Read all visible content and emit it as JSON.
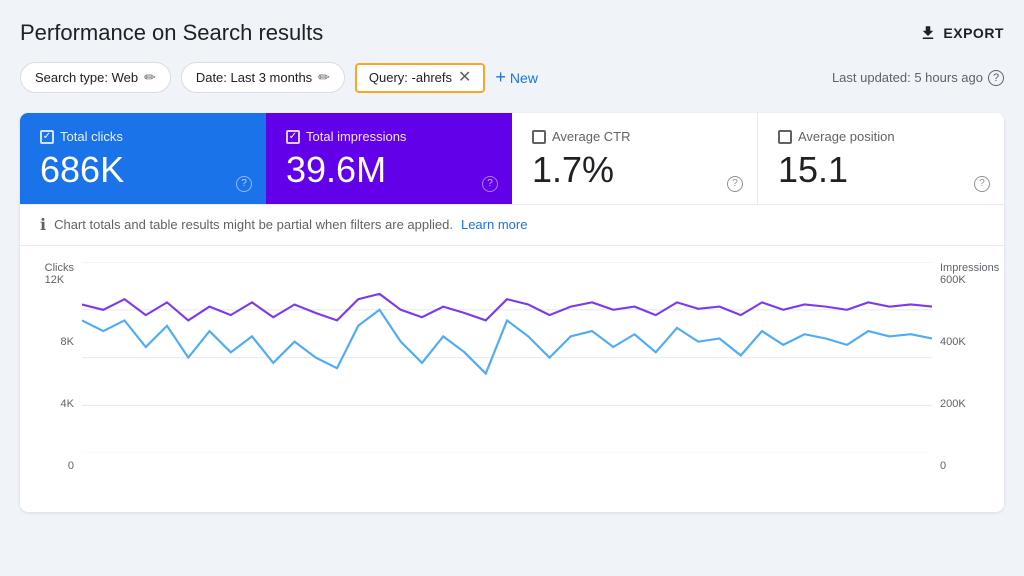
{
  "page": {
    "title": "Performance on Search results",
    "export_label": "EXPORT"
  },
  "filters": {
    "search_type": "Search type: Web",
    "date": "Date: Last 3 months",
    "query": "Query: -ahrefs",
    "new_label": "New",
    "last_updated": "Last updated: 5 hours ago"
  },
  "metrics": {
    "clicks": {
      "label": "Total clicks",
      "value": "686K",
      "checked": true
    },
    "impressions": {
      "label": "Total impressions",
      "value": "39.6M",
      "checked": true
    },
    "ctr": {
      "label": "Average CTR",
      "value": "1.7%",
      "checked": false
    },
    "position": {
      "label": "Average position",
      "value": "15.1",
      "checked": false
    }
  },
  "info_bar": {
    "text": "Chart totals and table results might be partial when filters are applied.",
    "link_text": "Learn more"
  },
  "chart": {
    "left_axis_label": "Clicks",
    "right_axis_label": "Impressions",
    "left_ticks": [
      "12K",
      "8K",
      "4K",
      "0"
    ],
    "right_ticks": [
      "600K",
      "400K",
      "200K",
      "0"
    ]
  },
  "colors": {
    "clicks_bg": "#1a73e8",
    "impressions_bg": "#6200ea",
    "clicks_line": "#4dabf7",
    "impressions_line": "#7c3aed",
    "accent_border": "#f9a825"
  }
}
